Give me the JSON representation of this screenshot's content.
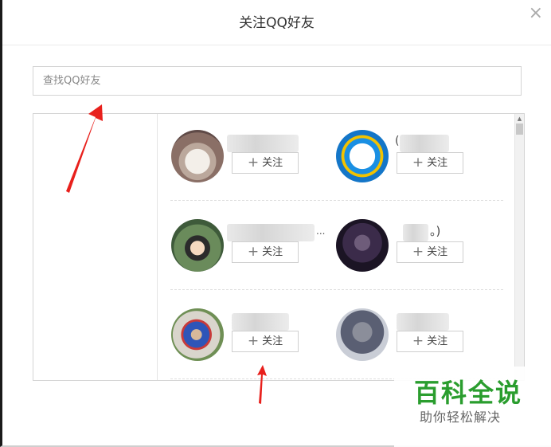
{
  "dialog": {
    "title": "关注QQ好友",
    "close_glyph": "×"
  },
  "search": {
    "placeholder": "查找QQ好友",
    "value": ""
  },
  "friends": [
    {
      "avatar": "avatar-girl-doll",
      "name_suffix": "",
      "follow_label": "关注"
    },
    {
      "avatar": "avatar-blue-check",
      "name_suffix": "(",
      "follow_label": "关注"
    },
    {
      "avatar": "avatar-cartoon-girl",
      "name_suffix": "...",
      "follow_label": "关注"
    },
    {
      "avatar": "avatar-band-stage",
      "name_suffix": "。)",
      "follow_label": "关注"
    },
    {
      "avatar": "avatar-superman-kid",
      "name_suffix": "",
      "follow_label": "关注"
    },
    {
      "avatar": "avatar-blurred-person",
      "name_suffix": "",
      "follow_label": "关注"
    }
  ],
  "follow_icon": "plus-icon",
  "watermark": {
    "title": "百科全说",
    "subtitle": "助你轻松解决"
  },
  "colors": {
    "accent_arrow": "#e8201c",
    "watermark_green": "#2a9d2e"
  }
}
